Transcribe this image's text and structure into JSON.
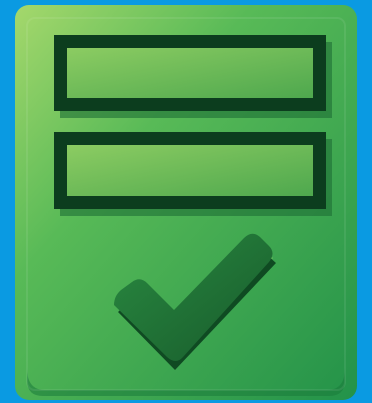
{
  "icon": {
    "name": "form-checkmark-icon",
    "colors": {
      "background": "#0a9ae2",
      "card_light": "#9ad26a",
      "card_mid": "#4db35a",
      "card_dark": "#22914a",
      "card_bottom_rim": "#1a7a3a",
      "field_frame": "#0c3d1e",
      "field_fill_light": "#7cc35e",
      "field_fill_dark": "#4aa34c",
      "check_fill": "#1e6b33",
      "check_shadow": "#0f4a22",
      "check_highlight": "#8bd36a"
    }
  }
}
